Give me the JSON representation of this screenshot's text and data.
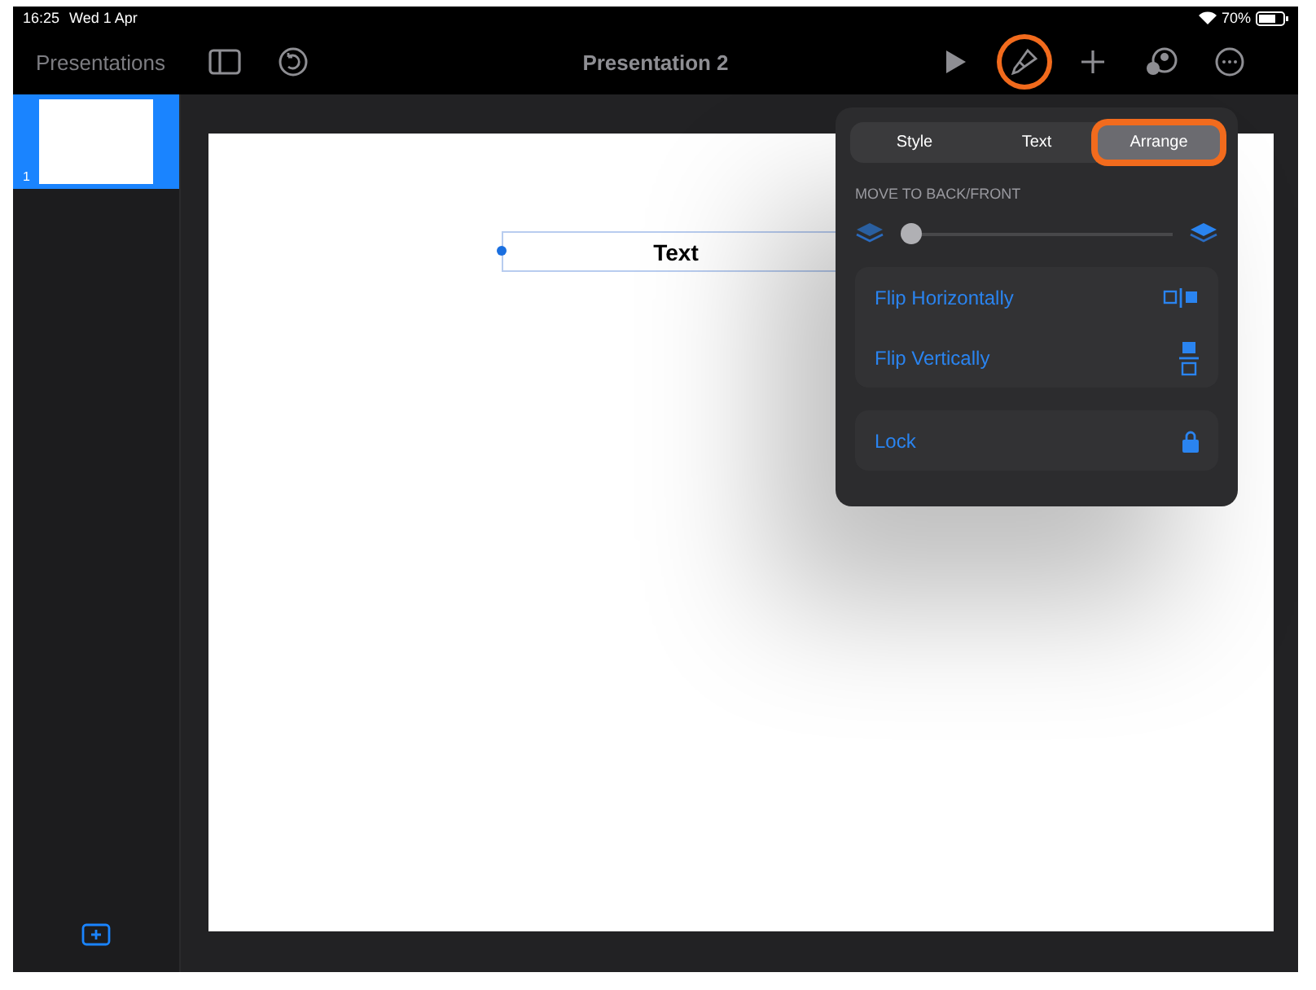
{
  "status_bar": {
    "time": "16:25",
    "date": "Wed 1 Apr",
    "battery": "70%"
  },
  "toolbar": {
    "back": "Presentations",
    "title": "Presentation 2",
    "left_tools": [
      {
        "kind": "sidebar"
      },
      {
        "kind": "undo"
      }
    ],
    "tools": [
      {
        "kind": "play",
        "highlighted": false
      },
      {
        "kind": "brush",
        "highlighted": true
      },
      {
        "kind": "add",
        "highlighted": false
      },
      {
        "kind": "collaborate",
        "highlighted": false
      },
      {
        "kind": "more",
        "highlighted": false
      }
    ]
  },
  "slides": [
    {
      "number": "1",
      "selected": true
    }
  ],
  "text_box": {
    "text": "Text",
    "selected": true
  },
  "popover": {
    "tabs": [
      {
        "label": "Style",
        "selected": false,
        "highlighted": false
      },
      {
        "label": "Text",
        "selected": false,
        "highlighted": false
      },
      {
        "label": "Arrange",
        "selected": true,
        "highlighted": true
      }
    ],
    "section": "MOVE TO BACK/FRONT",
    "slider": {
      "level": 0
    },
    "groups": [
      {
        "items": [
          {
            "label": "Flip Horizontally",
            "kind": "flip-h"
          },
          {
            "label": "Flip Vertically",
            "kind": "flip-v"
          }
        ]
      },
      {
        "items": [
          {
            "label": "Lock",
            "kind": "lock"
          }
        ]
      }
    ]
  }
}
